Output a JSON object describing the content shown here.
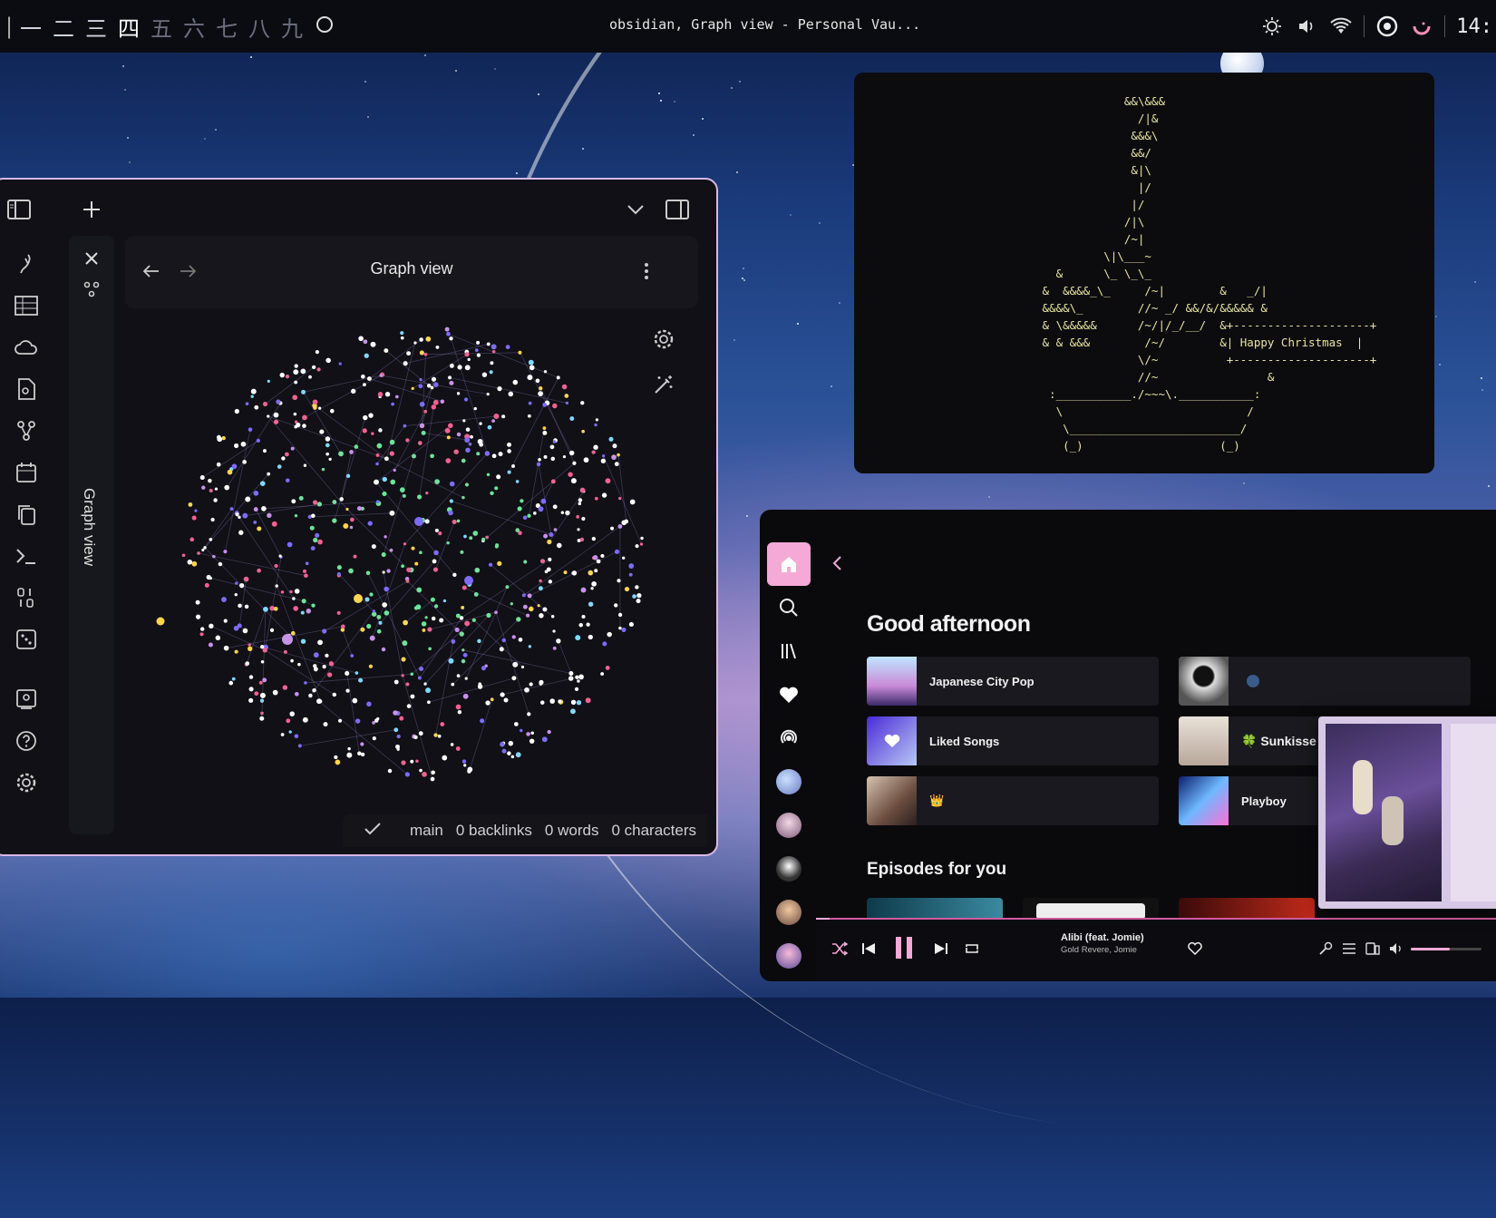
{
  "topbar": {
    "workspaces": [
      "一",
      "二",
      "三",
      "四",
      "五",
      "六",
      "七",
      "八",
      "九"
    ],
    "window_title": "obsidian, Graph view - Personal Vau...",
    "clock": "14:"
  },
  "obsidian": {
    "view_title": "Graph view",
    "side_label": "Graph view",
    "status": {
      "branch": "main",
      "backlinks": "0 backlinks",
      "words": "0 words",
      "characters": "0 characters"
    },
    "graph_colors": [
      "#6ee39a",
      "#ffffff",
      "#f06292",
      "#7c6cf6",
      "#ffd54f",
      "#c792ea",
      "#80d8ff"
    ]
  },
  "terminal": {
    "art_lines": [
      "             &&\\&&&",
      "               /|&",
      "              &&&\\",
      "              &&/",
      "              &|\\",
      "               |/",
      "              |/",
      "             /|\\",
      "             /~|",
      "          \\|\\___~",
      "   &      \\_ \\_\\_",
      " &  &&&&_\\_     /~|        &   _/|",
      " &&&&\\_        //~ _/ &&/&/&&&&& &",
      " & \\&&&&&      /~/|/_/__/  &+--------------------+",
      " & & &&&        /~/        &| Happy Christmas  |",
      "               \\/~          +--------------------+",
      "               //~                &",
      "  :___________./~~~\\.___________:",
      "   \\                           /",
      "    \\_________________________/",
      "    (_)                    (_)"
    ],
    "greeting_box": "Happy Christmas"
  },
  "spotify": {
    "greeting": "Good afternoon",
    "shortcuts": [
      {
        "label": "Japanese City Pop"
      },
      {
        "label": ""
      },
      {
        "label": "Liked Songs"
      },
      {
        "label": "🍀 Sunkisse"
      },
      {
        "label": "👑"
      },
      {
        "label": "Playboy"
      }
    ],
    "section_title": "Episodes for you",
    "now_playing": {
      "title": "Alibi (feat. Jomie)",
      "artist": "Gold Revere, Jomie",
      "progress": 0.02,
      "volume": 0.55
    },
    "accent": "#f4a9d6"
  }
}
